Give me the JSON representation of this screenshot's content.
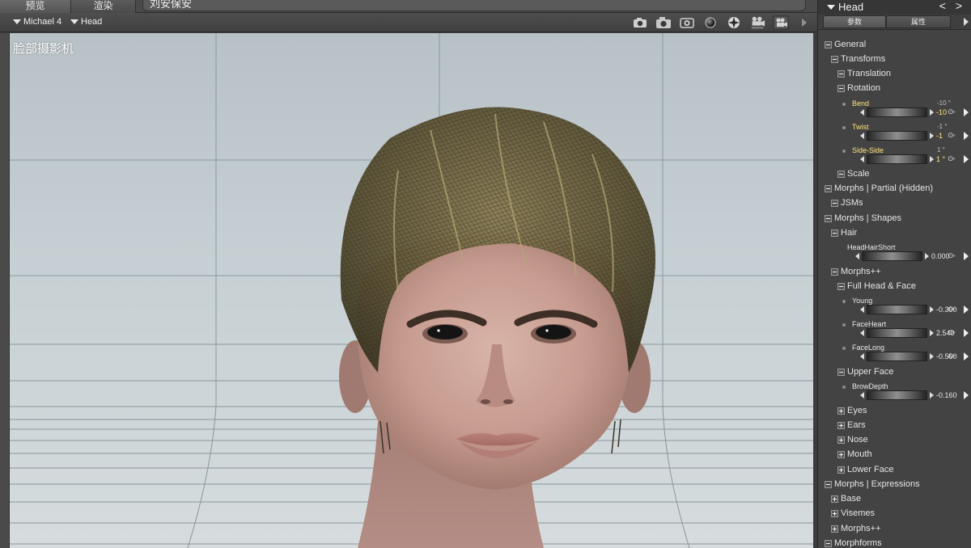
{
  "tabs": [
    {
      "label": "预览"
    },
    {
      "label": "渲染"
    }
  ],
  "scene_title": "刘安保安",
  "viewport": {
    "figure_label": "Michael 4",
    "node_label": "Head",
    "camera_label": "脸部摄影机"
  },
  "camera_icons": [
    "camera-icon",
    "camera-icon",
    "camera-icon",
    "sphere-icon",
    "globe-icon",
    "movie-camera-icon",
    "movie-camera-icon"
  ],
  "panel": {
    "title": "Head",
    "nav": "< >",
    "tab_params": "参数",
    "tab_props": "属性",
    "tree": {
      "general": "General",
      "transforms": "Transforms",
      "translation": "Translation",
      "rotation": "Rotation",
      "bend": {
        "label": "Bend",
        "value": "-10",
        "top": "-10 °"
      },
      "twist": {
        "label": "Twist",
        "value": "-1",
        "top": "-1 °"
      },
      "side_side": {
        "label": "Side-Side",
        "value": "1 °",
        "top": "1 °"
      },
      "scale": "Scale",
      "morphs_partial": "Morphs | Partial (Hidden)",
      "jsms": "JSMs",
      "morphs_shapes": "Morphs | Shapes",
      "hair": "Hair",
      "headhairshort": {
        "label": "HeadHairShort",
        "value": "0.000"
      },
      "morphspp": "Morphs++",
      "full_head_face": "Full Head & Face",
      "young": {
        "label": "Young",
        "value": "-0.300"
      },
      "faceheart": {
        "label": "FaceHeart",
        "value": "2.540"
      },
      "facelong": {
        "label": "FaceLong",
        "value": "-0.560"
      },
      "upper_face": "Upper Face",
      "browdepth": {
        "label": "BrowDepth",
        "value": "-0.160"
      },
      "eyes": "Eyes",
      "ears": "Ears",
      "nose": "Nose",
      "mouth": "Mouth",
      "lower_face": "Lower Face",
      "morphs_expressions": "Morphs | Expressions",
      "base": "Base",
      "visemes": "Visemes",
      "morphspp2": "Morphs++",
      "morphforms": "Morphforms"
    }
  },
  "colors": {
    "panel_bg": "#434343",
    "highlight": "#ffe37a",
    "viewport_bg": "#c5cfd3"
  }
}
